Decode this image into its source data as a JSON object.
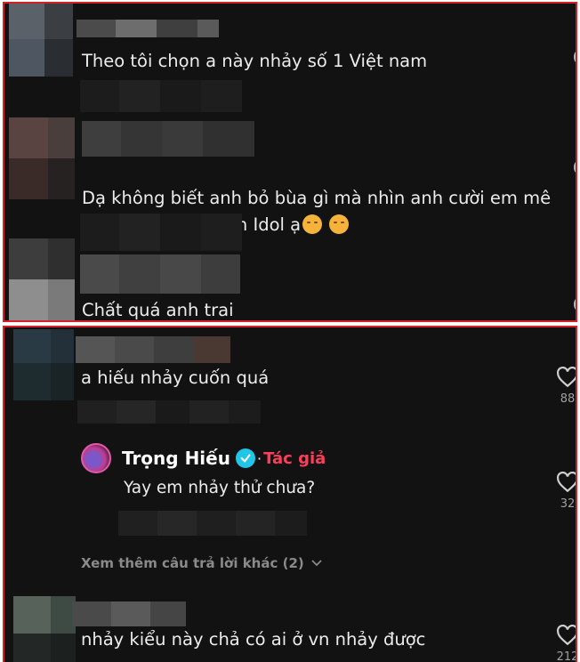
{
  "colors": {
    "panel_bg": "#121212",
    "highlight_border": "#d61f26",
    "author_tag": "#fe3d5a",
    "verified": "#20c5e7"
  },
  "top_panel": {
    "comments": [
      {
        "text": "Theo tôi chọn a này nhảy số 1 Việt nam"
      },
      {
        "text": "Dạ không biết anh bỏ bùa gì mà nhìn anh cười em mê\nanh từ hồi Vietnam Idol ạ",
        "emoji_count": 2,
        "emoji": "hugging-face-icon"
      },
      {
        "text": "Chất quá anh trai"
      }
    ]
  },
  "bottom_panel": {
    "comment_1": {
      "text": "a hiếu nhảy cuốn quá",
      "likes": "88"
    },
    "reply": {
      "author": "Trọng Hiếu",
      "separator": "·",
      "tag": "Tác giả",
      "text": "Yay em nhảy thử chưa?",
      "likes": "32"
    },
    "more_replies": {
      "label": "Xem thêm câu trả lời khác (2)",
      "icon": "chevron-down-icon"
    },
    "comment_2": {
      "text": "nhảy kiểu này chả có ai ở vn nhảy được",
      "likes": "212"
    }
  }
}
